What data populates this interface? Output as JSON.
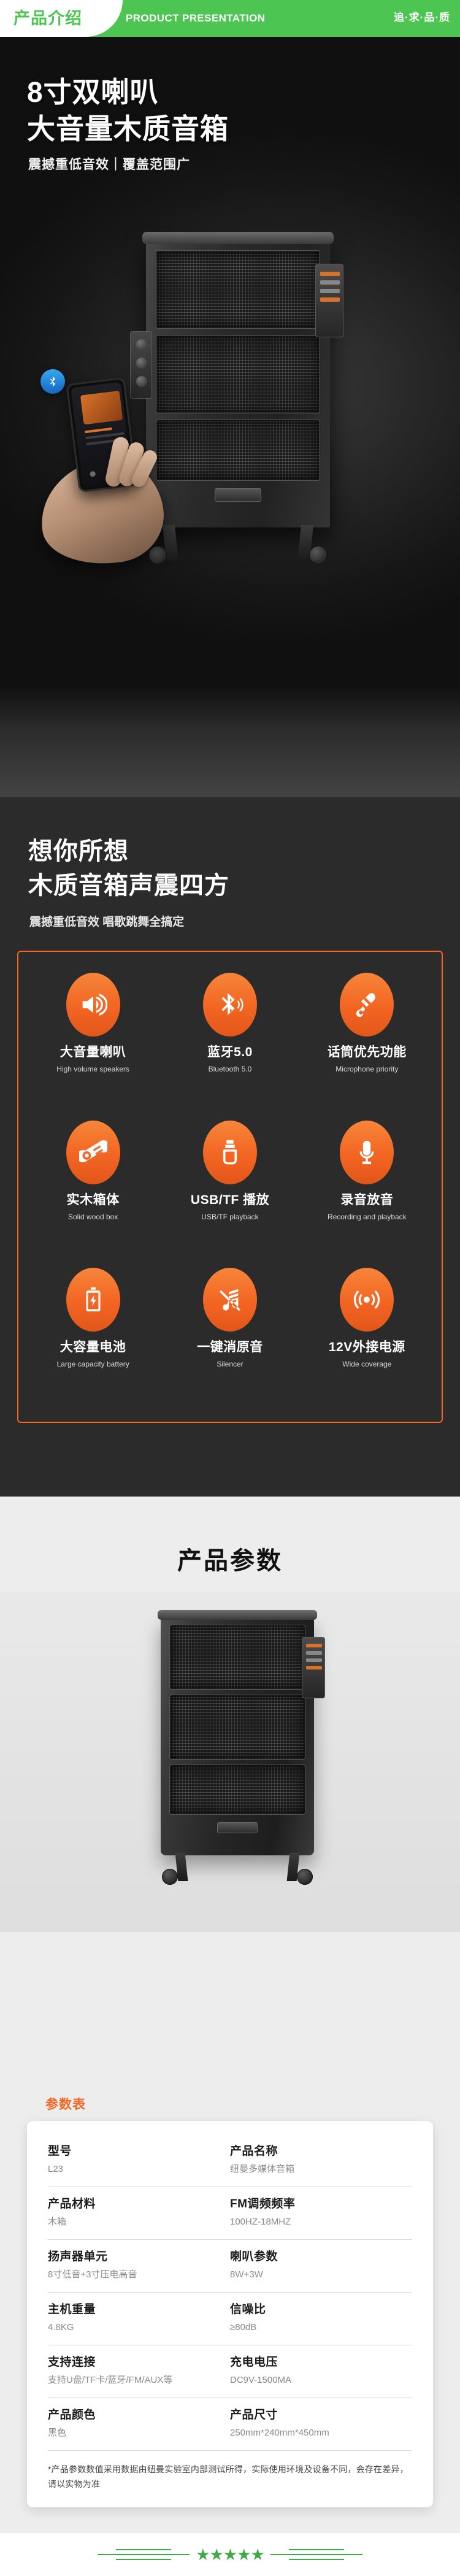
{
  "header": {
    "cn_title": "产品介绍",
    "en_title": "PRODUCT PRESENTATION",
    "slogan": "追·求·品·质"
  },
  "hero": {
    "headline": "8寸双喇叭\n大音量木质音箱",
    "subtitle": "震撼重低音效｜覆盖范围广",
    "bluetooth_icon": "bluetooth-icon"
  },
  "features_section": {
    "headline": "想你所想\n木质音箱声震四方",
    "subtitle": "震撼重低音效 唱歌跳舞全搞定",
    "accent_color": "#f26522",
    "items": [
      {
        "icon": "speaker-volume-icon",
        "cn": "大音量喇叭",
        "en": "High volume speakers"
      },
      {
        "icon": "bluetooth-icon",
        "cn": "蓝牙5.0",
        "en": "Bluetooth 5.0"
      },
      {
        "icon": "handheld-microphone-icon",
        "cn": "话筒优先功能",
        "en": "Microphone priority"
      },
      {
        "icon": "wood-log-icon",
        "cn": "实木箱体",
        "en": "Solid wood box"
      },
      {
        "icon": "usb-drive-icon",
        "cn": "USB/TF 播放",
        "en": "USB/TF playback"
      },
      {
        "icon": "studio-microphone-icon",
        "cn": "录音放音",
        "en": "Recording and playback"
      },
      {
        "icon": "battery-charging-icon",
        "cn": "大容量电池",
        "en": "Large capacity battery"
      },
      {
        "icon": "music-note-muted-icon",
        "cn": "一键消原音",
        "en": "Silencer"
      },
      {
        "icon": "wireless-signal-icon",
        "cn": "12V外接电源",
        "en": "Wide coverage"
      }
    ]
  },
  "params_section": {
    "title": "产品参数",
    "table_label": "参数表",
    "rows": [
      {
        "left_key": "型号",
        "left_value": "L23",
        "right_key": "产品名称",
        "right_value": "纽曼多媒体音箱"
      },
      {
        "left_key": "产品材料",
        "left_value": "木箱",
        "right_key": "FM调频频率",
        "right_value": "100HZ-18MHZ"
      },
      {
        "left_key": "扬声器单元",
        "left_value": "8寸低音+3寸压电高音",
        "right_key": "喇叭参数",
        "right_value": "8W+3W"
      },
      {
        "left_key": "主机重量",
        "left_value": "4.8KG",
        "right_key": "信噪比",
        "right_value": "≥80dB"
      },
      {
        "left_key": "支持连接",
        "left_value": "支持U盘/TF卡/蓝牙/FM/AUX等",
        "right_key": "充电电压",
        "right_value": "DC9V-1500MA"
      },
      {
        "left_key": "产品颜色",
        "left_value": "黑色",
        "right_key": "产品尺寸",
        "right_value": "250mm*240mm*450mm"
      }
    ],
    "note": "*产品参数数值采用数据由纽曼实验室内部测试所得，实际使用环境及设备不同，会存在差异，请以实物为准"
  },
  "footer": {
    "stars": "★★★★★",
    "star_color": "#3faa46"
  }
}
